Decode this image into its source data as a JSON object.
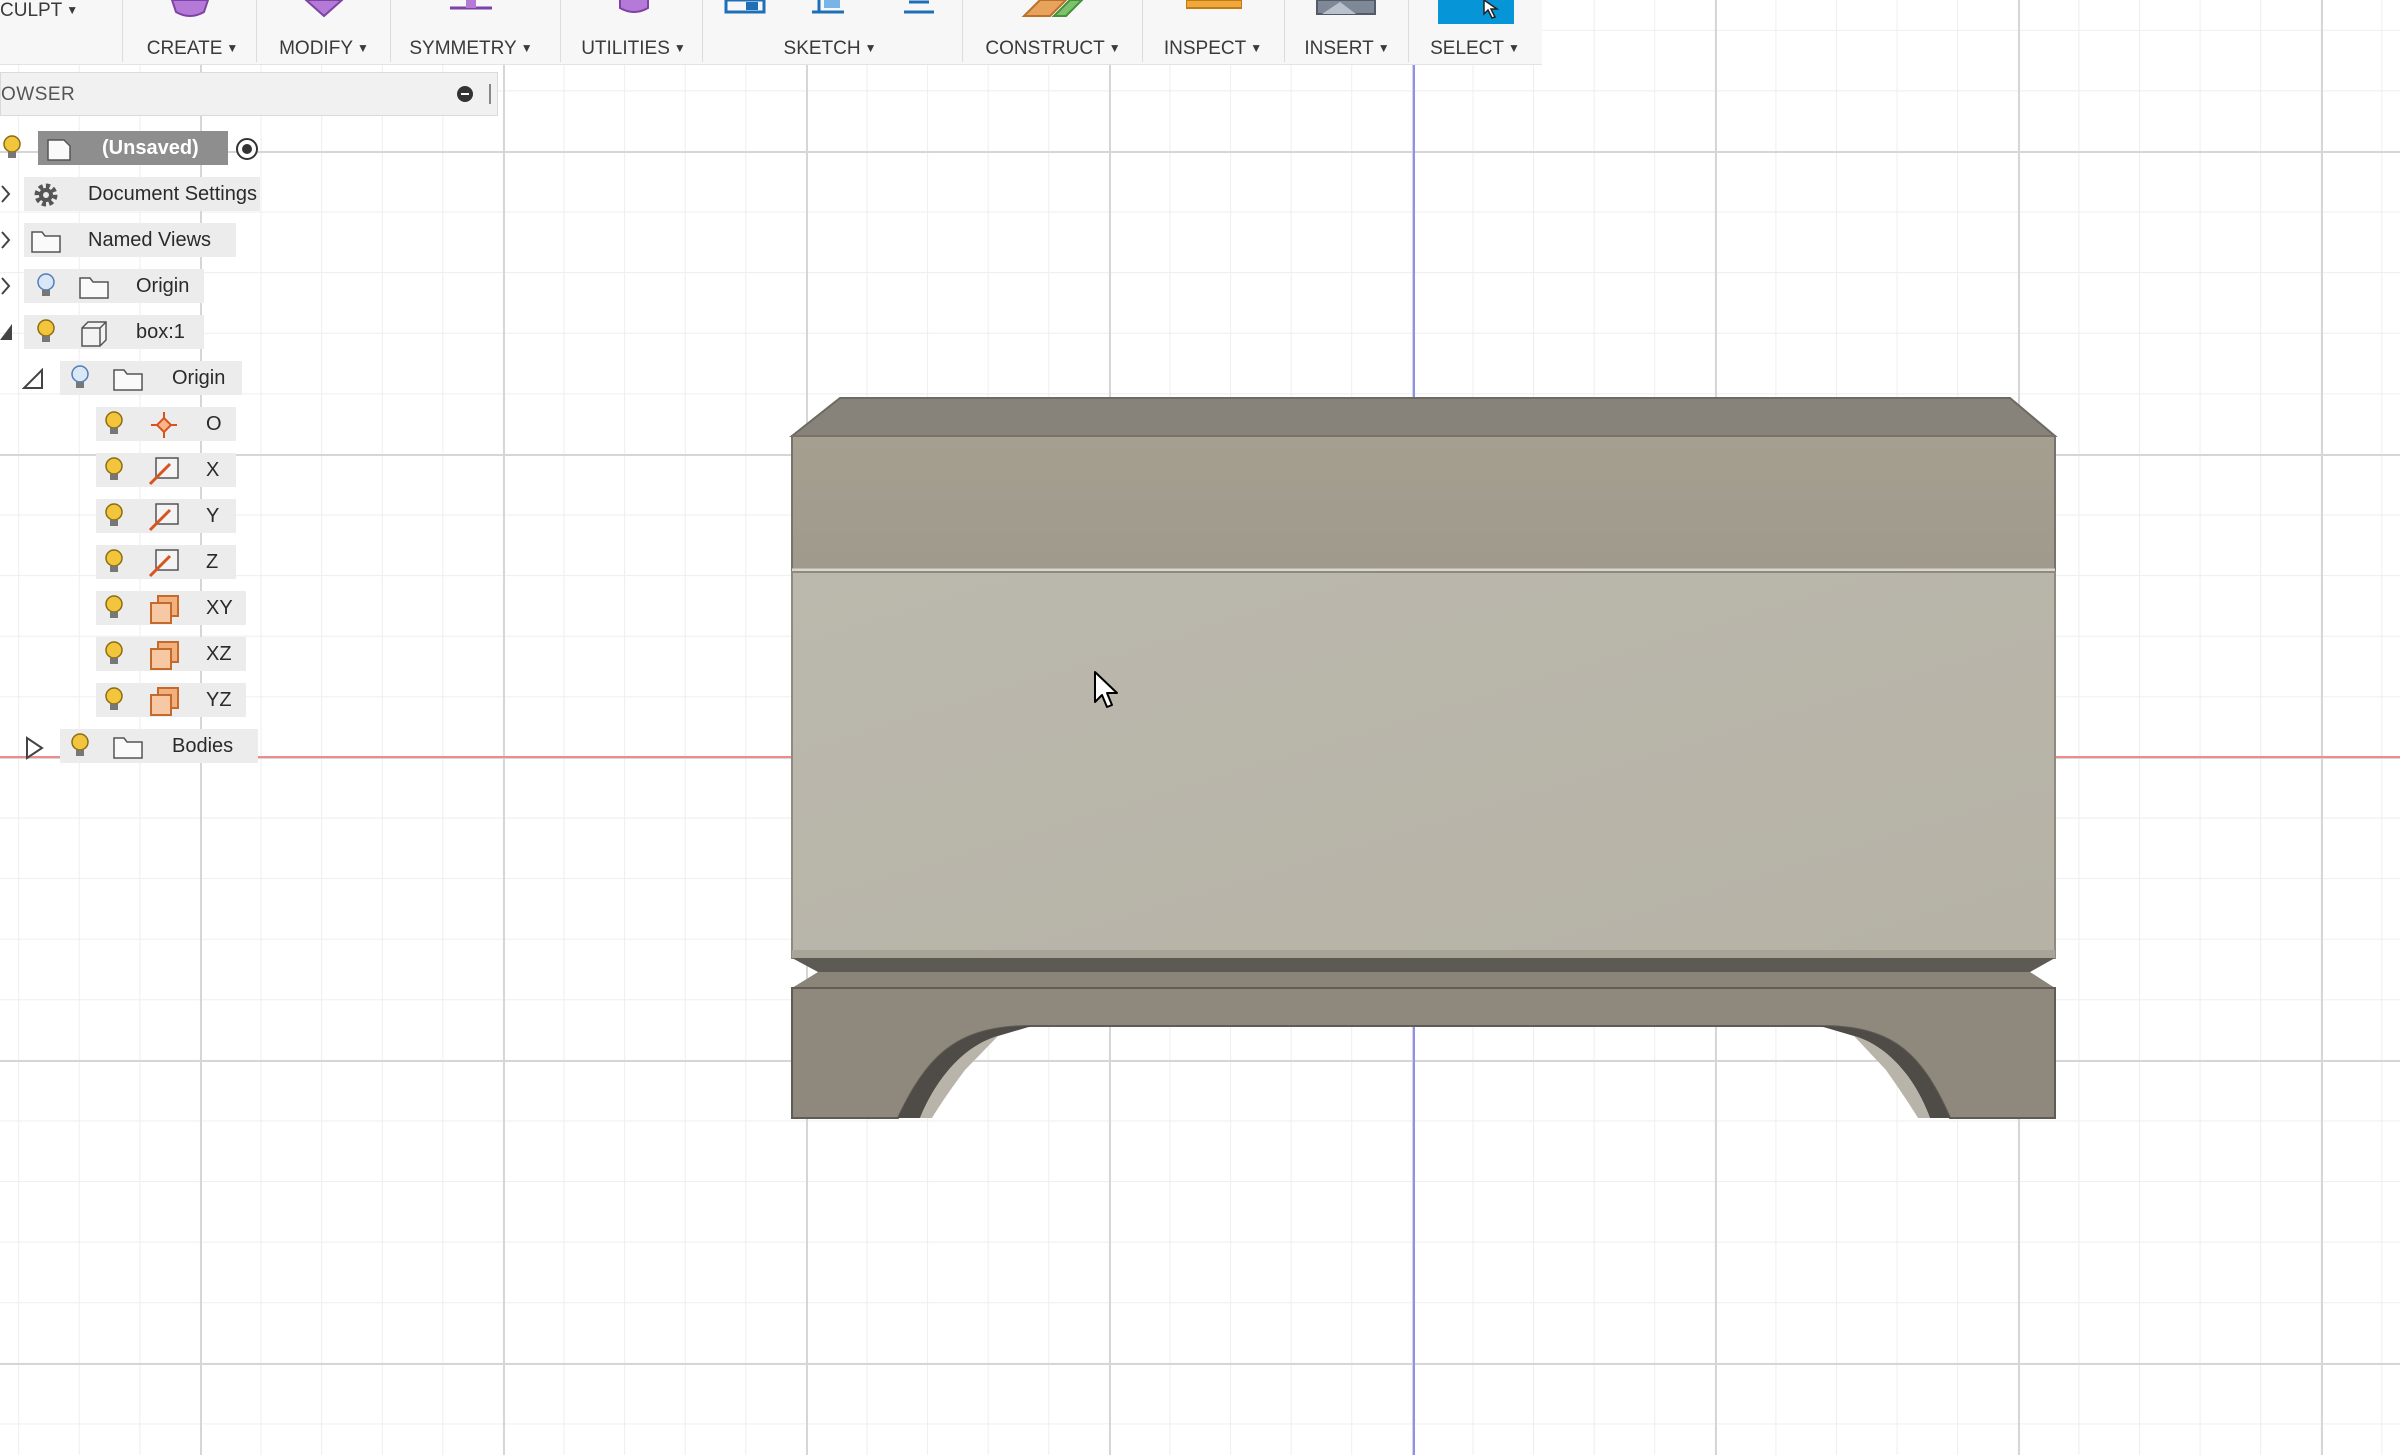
{
  "toolbar": {
    "workspace": "CULPT",
    "groups": [
      {
        "label": "CREATE"
      },
      {
        "label": "MODIFY"
      },
      {
        "label": "SYMMETRY"
      },
      {
        "label": "UTILITIES"
      },
      {
        "label": "SKETCH"
      },
      {
        "label": "CONSTRUCT"
      },
      {
        "label": "INSPECT"
      },
      {
        "label": "INSERT"
      },
      {
        "label": "SELECT"
      }
    ]
  },
  "browser": {
    "title": "OWSER",
    "items": [
      {
        "label": "(Unsaved)",
        "icon": "component-icon"
      },
      {
        "label": "Document Settings",
        "icon": "gear-icon"
      },
      {
        "label": "Named Views",
        "icon": "folder-icon"
      },
      {
        "label": "Origin",
        "icon": "folder-icon"
      },
      {
        "label": "box:1",
        "icon": "body-icon"
      },
      {
        "label": "Origin",
        "icon": "folder-icon"
      },
      {
        "label": "O",
        "icon": "origin-point-icon"
      },
      {
        "label": "X",
        "icon": "axis-icon"
      },
      {
        "label": "Y",
        "icon": "axis-icon"
      },
      {
        "label": "Z",
        "icon": "axis-icon"
      },
      {
        "label": "XY",
        "icon": "plane-icon"
      },
      {
        "label": "XZ",
        "icon": "plane-icon"
      },
      {
        "label": "YZ",
        "icon": "plane-icon"
      },
      {
        "label": "Bodies",
        "icon": "folder-icon"
      }
    ]
  },
  "colors": {
    "accent": "#0696d7",
    "x_axis": "#f08b8b",
    "y_axis": "#8f8ff2",
    "model_light": "#bdb9ad",
    "model_mid": "#a39d8e",
    "model_dark": "#8e897b"
  }
}
